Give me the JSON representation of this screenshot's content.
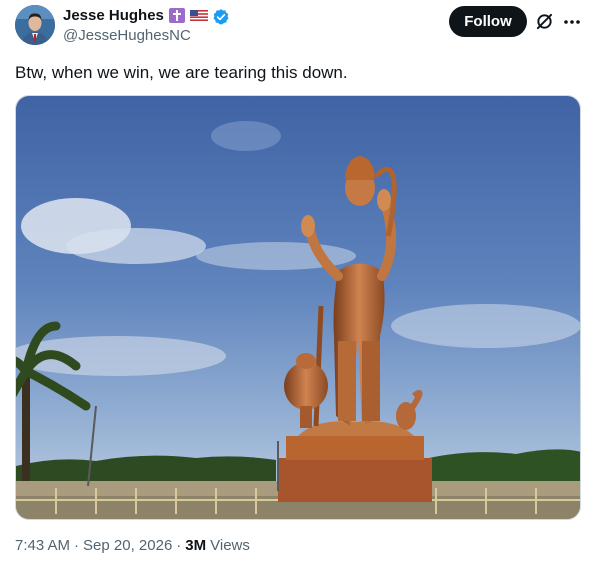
{
  "author": {
    "display_name": "Jesse Hughes",
    "handle": "@JesseHughesNC",
    "badges": [
      "cross-badge-icon",
      "us-flag-icon",
      "verified-badge-icon"
    ]
  },
  "actions": {
    "follow_label": "Follow",
    "grok_icon": "grok-icon",
    "more_icon": "more-icon"
  },
  "tweet": {
    "text": "Btw, when we win, we are tearing this down.",
    "media_description": "photo"
  },
  "meta": {
    "time": "7:43 AM",
    "separator": "·",
    "date": "Sep 20, 2026",
    "views_count": "3M",
    "views_label": "Views"
  },
  "colors": {
    "text_primary": "#0f1419",
    "text_secondary": "#536471",
    "verified_blue": "#1d9bf0",
    "follow_bg": "#0f1419",
    "badge_purple": "#9b6cc7"
  }
}
